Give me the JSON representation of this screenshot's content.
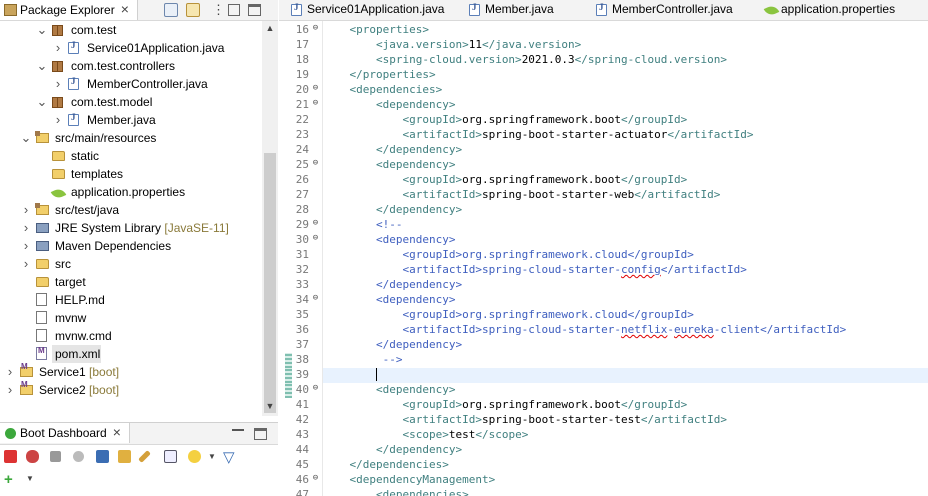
{
  "package_explorer": {
    "tab_label": "Package Explorer",
    "tree": [
      {
        "indent": 2,
        "twisty": "v",
        "icon": "package-icon",
        "label": "com.test"
      },
      {
        "indent": 3,
        "twisty": ">",
        "icon": "java-file-icon",
        "label": "Service01Application.java"
      },
      {
        "indent": 2,
        "twisty": "v",
        "icon": "package-icon",
        "label": "com.test.controllers"
      },
      {
        "indent": 3,
        "twisty": ">",
        "icon": "java-file-icon",
        "label": "MemberController.java"
      },
      {
        "indent": 2,
        "twisty": "v",
        "icon": "package-icon",
        "label": "com.test.model"
      },
      {
        "indent": 3,
        "twisty": ">",
        "icon": "java-file-icon",
        "label": "Member.java"
      },
      {
        "indent": 1,
        "twisty": "v",
        "icon": "source-folder-icon",
        "label": "src/main/resources"
      },
      {
        "indent": 2,
        "twisty": "",
        "icon": "folder-icon",
        "label": "static"
      },
      {
        "indent": 2,
        "twisty": "",
        "icon": "folder-icon",
        "label": "templates"
      },
      {
        "indent": 2,
        "twisty": "",
        "icon": "spring-leaf-icon",
        "label": "application.properties"
      },
      {
        "indent": 1,
        "twisty": ">",
        "icon": "source-folder-icon",
        "label": "src/test/java"
      },
      {
        "indent": 1,
        "twisty": ">",
        "icon": "library-icon",
        "label": "JRE System Library",
        "suffix": "[JavaSE-11]"
      },
      {
        "indent": 1,
        "twisty": ">",
        "icon": "library-icon",
        "label": "Maven Dependencies"
      },
      {
        "indent": 1,
        "twisty": ">",
        "icon": "folder-icon",
        "label": "src"
      },
      {
        "indent": 1,
        "twisty": "",
        "icon": "folder-icon",
        "label": "target"
      },
      {
        "indent": 1,
        "twisty": "",
        "icon": "file-icon",
        "label": "HELP.md"
      },
      {
        "indent": 1,
        "twisty": "",
        "icon": "file-icon",
        "label": "mvnw"
      },
      {
        "indent": 1,
        "twisty": "",
        "icon": "file-icon",
        "label": "mvnw.cmd"
      },
      {
        "indent": 1,
        "twisty": "",
        "icon": "xml-file-icon",
        "label": "pom.xml",
        "selected": true
      },
      {
        "indent": 0,
        "twisty": ">",
        "icon": "project-icon",
        "label": "Service1",
        "suffix": "[boot]"
      },
      {
        "indent": 0,
        "twisty": ">",
        "icon": "project-icon",
        "label": "Service2",
        "suffix": "[boot]"
      }
    ]
  },
  "boot_dashboard": {
    "tab_label": "Boot Dashboard"
  },
  "editor": {
    "tabs": [
      {
        "label": "Service01Application.java",
        "icon": "java-file-icon"
      },
      {
        "label": "Member.java",
        "icon": "java-file-icon"
      },
      {
        "label": "MemberController.java",
        "icon": "java-file-icon"
      },
      {
        "label": "application.properties",
        "icon": "spring-leaf-icon"
      }
    ],
    "current_line": 39,
    "lines": [
      {
        "n": "16",
        "fold": "⊖",
        "text": "    <properties>"
      },
      {
        "n": "17",
        "fold": "",
        "text": "        <java.version>11</java.version>"
      },
      {
        "n": "18",
        "fold": "",
        "text": "        <spring-cloud.version>2021.0.3</spring-cloud.version>"
      },
      {
        "n": "19",
        "fold": "",
        "text": "    </properties>"
      },
      {
        "n": "20",
        "fold": "⊖",
        "text": "    <dependencies>"
      },
      {
        "n": "21",
        "fold": "⊖",
        "text": "        <dependency>"
      },
      {
        "n": "22",
        "fold": "",
        "text": "            <groupId>org.springframework.boot</groupId>"
      },
      {
        "n": "23",
        "fold": "",
        "text": "            <artifactId>spring-boot-starter-actuator</artifactId>"
      },
      {
        "n": "24",
        "fold": "",
        "text": "        </dependency>"
      },
      {
        "n": "25",
        "fold": "⊖",
        "text": "        <dependency>"
      },
      {
        "n": "26",
        "fold": "",
        "text": "            <groupId>org.springframework.boot</groupId>"
      },
      {
        "n": "27",
        "fold": "",
        "text": "            <artifactId>spring-boot-starter-web</artifactId>"
      },
      {
        "n": "28",
        "fold": "",
        "text": "        </dependency>"
      },
      {
        "n": "29",
        "fold": "⊖",
        "text": "        <!--"
      },
      {
        "n": "30",
        "fold": "⊖",
        "text": "        <dependency>"
      },
      {
        "n": "31",
        "fold": "",
        "text": "            <groupId>org.springframework.cloud</groupId>"
      },
      {
        "n": "32",
        "fold": "",
        "text": "            <artifactId>spring-cloud-starter-config</artifactId>"
      },
      {
        "n": "33",
        "fold": "",
        "text": "        </dependency>"
      },
      {
        "n": "34",
        "fold": "⊖",
        "text": "        <dependency>"
      },
      {
        "n": "35",
        "fold": "",
        "text": "            <groupId>org.springframework.cloud</groupId>"
      },
      {
        "n": "36",
        "fold": "",
        "text": "            <artifactId>spring-cloud-starter-netflix-eureka-client</artifactId>"
      },
      {
        "n": "37",
        "fold": "",
        "text": "        </dependency>"
      },
      {
        "n": "38",
        "fold": "",
        "text": "         -->"
      },
      {
        "n": "39",
        "fold": "",
        "text": "        "
      },
      {
        "n": "40",
        "fold": "⊖",
        "text": "        <dependency>"
      },
      {
        "n": "41",
        "fold": "",
        "text": "            <groupId>org.springframework.boot</groupId>"
      },
      {
        "n": "42",
        "fold": "",
        "text": "            <artifactId>spring-boot-starter-test</artifactId>"
      },
      {
        "n": "43",
        "fold": "",
        "text": "            <scope>test</scope>"
      },
      {
        "n": "44",
        "fold": "",
        "text": "        </dependency>"
      },
      {
        "n": "45",
        "fold": "",
        "text": "    </dependencies>"
      },
      {
        "n": "46",
        "fold": "⊖",
        "text": "    <dependencyManagement>"
      },
      {
        "n": "47",
        "fold": "",
        "text": "        <dependencies>"
      }
    ],
    "comment_range": [
      29,
      38
    ]
  },
  "colors": {
    "tag": "#3f7f7f",
    "comment": "#3f5fbf",
    "current_line": "#e8f2fe",
    "selection": "#e5e5e5"
  }
}
